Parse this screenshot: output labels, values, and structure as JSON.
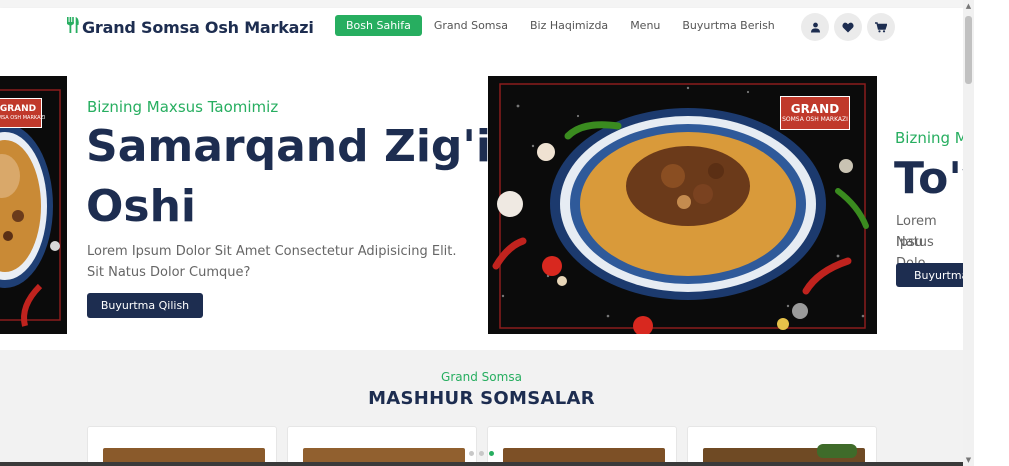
{
  "header": {
    "brand": "Grand Somsa Osh Markazi",
    "nav": [
      {
        "label": "Bosh Sahifa",
        "active": true
      },
      {
        "label": "Grand Somsa",
        "active": false
      },
      {
        "label": "Biz Haqimizda",
        "active": false
      },
      {
        "label": "Menu",
        "active": false
      },
      {
        "label": "Buyurtma Berish",
        "active": false
      }
    ],
    "icons": [
      "user-icon",
      "heart-icon",
      "cart-icon"
    ]
  },
  "hero": {
    "slides": [
      {
        "subtitle": "Bizning Maxsus Taomimiz",
        "title_line1": "Samarqand Zig'ir",
        "title_line2": "Oshi",
        "description": "Lorem Ipsum Dolor Sit Amet Consectetur Adipisicing Elit. Sit Natus Dolor Cumque?",
        "button": "Buyurtma Qilish"
      },
      {
        "subtitle": "Bizning M",
        "title": "To'y",
        "description_line1": "Lorem Ipsu",
        "description_line2": "Natus Dolo",
        "button": "Buyurtma"
      }
    ],
    "image_badge": {
      "line1": "GRAND",
      "line2": "SOMSA OSH MARKAZI"
    }
  },
  "section": {
    "subtitle": "Grand Somsa",
    "title": "MASHHUR SOMSALAR",
    "cards_count": 4,
    "dots": 3,
    "active_dot": 3
  },
  "colors": {
    "primary": "#1d2d50",
    "accent": "#27ae60",
    "image_bg": "#0b0b0b",
    "badge": "#c0392b"
  }
}
